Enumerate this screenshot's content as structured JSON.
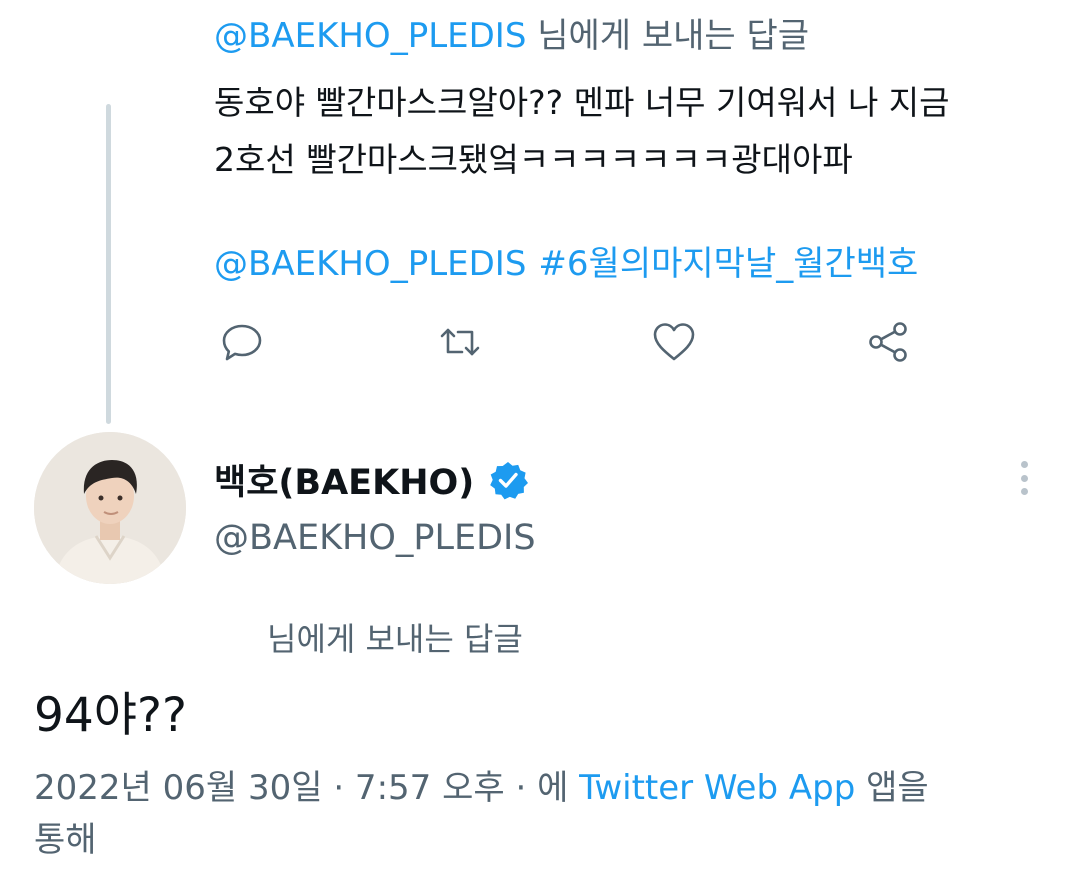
{
  "parent_tweet": {
    "reply_to_handle": "@BAEKHO_PLEDIS",
    "reply_to_suffix": " 님에게 보내는 답글",
    "text_line1": "동호야 빨간마스크알아?? 멘파 너무 기여워서 나 지금",
    "text_line2": "2호선 빨간마스크됐엌ㅋㅋㅋㅋㅋㅋㅋ광대아파",
    "mention": "@BAEKHO_PLEDIS",
    "hashtag": "#6월의마지막날_월간백호",
    "actions": {
      "reply_icon": "speech-bubble-icon",
      "retweet_icon": "retweet-icon",
      "like_icon": "heart-icon",
      "share_icon": "share-icon"
    }
  },
  "main_tweet": {
    "author_name": "백호(BAEKHO)",
    "author_handle": "@BAEKHO_PLEDIS",
    "verified": true,
    "reply_to_label": "님에게 보내는 답글",
    "text": "94야??",
    "date": "2022년 06월 30일 · 7:57 오후 · 에 ",
    "source": "Twitter Web App",
    "source_suffix": " 앱을",
    "via": "통해"
  },
  "colors": {
    "accent": "#1d9bf0",
    "secondary_text": "#536471",
    "primary_text": "#0f1419",
    "thread_line": "#cfd9de"
  }
}
